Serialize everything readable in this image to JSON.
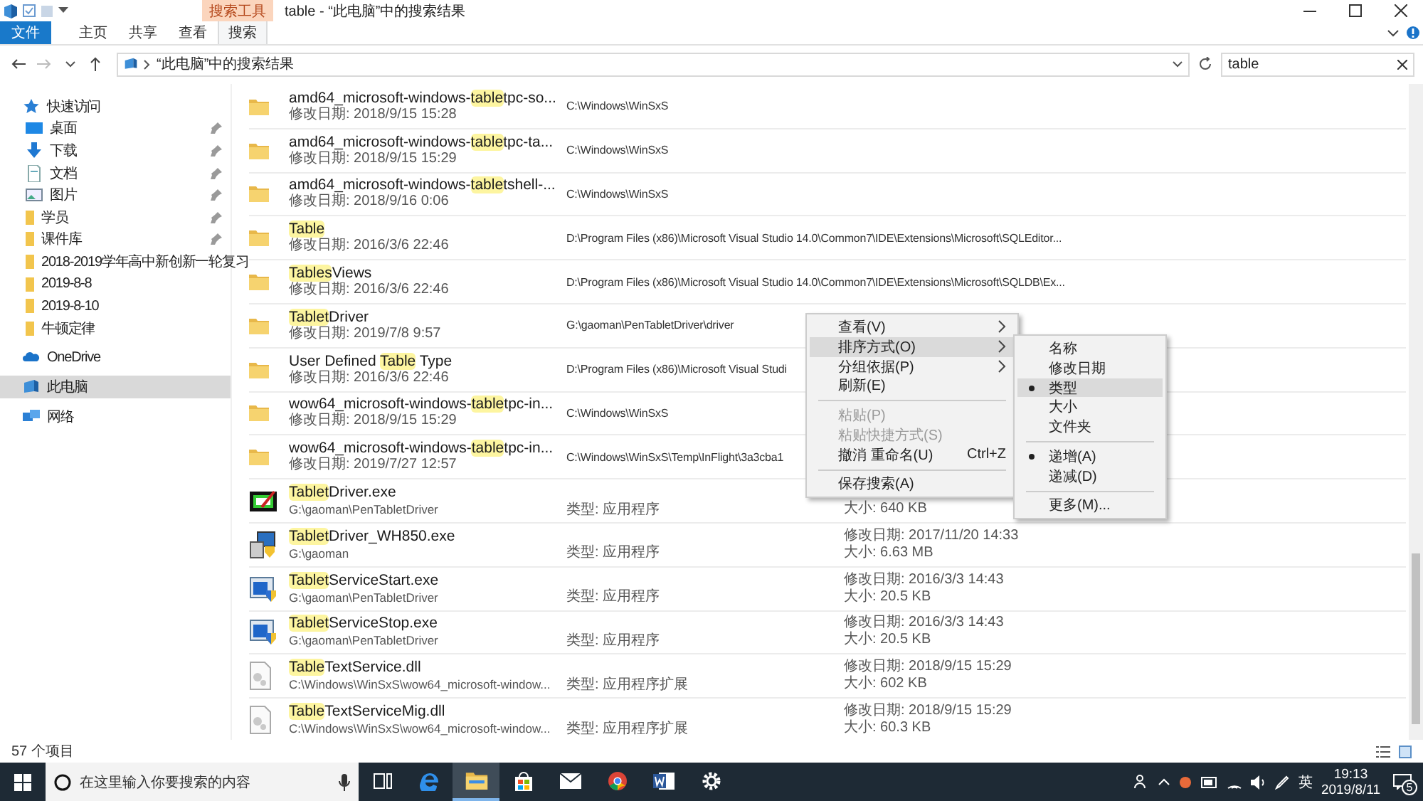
{
  "title_bar": {
    "contextual_tab": "搜索工具",
    "title": "table - “此电脑”中的搜索结果"
  },
  "ribbon_tabs": [
    {
      "label": "文件",
      "kind": "file",
      "selected": false
    },
    {
      "label": "主页",
      "kind": "tab",
      "selected": false
    },
    {
      "label": "共享",
      "kind": "tab",
      "selected": false
    },
    {
      "label": "查看",
      "kind": "tab",
      "selected": false
    },
    {
      "label": "搜索",
      "kind": "tab",
      "selected": true
    }
  ],
  "address": {
    "path": "“此电脑”中的搜索结果"
  },
  "search": {
    "value": "table"
  },
  "sidebar": {
    "items": [
      {
        "label": "快速访问",
        "kind": "star",
        "selected": false,
        "pinned": false,
        "children": [
          {
            "label": "桌面",
            "kind": "desktop",
            "selected": false,
            "pinned": true
          },
          {
            "label": "下载",
            "kind": "download",
            "selected": false,
            "pinned": true
          },
          {
            "label": "文档",
            "kind": "document",
            "selected": false,
            "pinned": true
          },
          {
            "label": "图片",
            "kind": "pictures",
            "selected": false,
            "pinned": true
          },
          {
            "label": "学员",
            "kind": "folder",
            "selected": false,
            "pinned": true
          },
          {
            "label": "课件库",
            "kind": "folder",
            "selected": false,
            "pinned": true
          },
          {
            "label": "2018-2019学年高中新创新一轮复习",
            "kind": "folder",
            "selected": false
          },
          {
            "label": "2019-8-8",
            "kind": "folder",
            "selected": false,
            "pinned": false
          },
          {
            "label": "2019-8-10",
            "kind": "folder",
            "selected": false,
            "pinned": false
          },
          {
            "label": "牛顿定律",
            "kind": "folder",
            "selected": false,
            "pinned": false
          }
        ]
      },
      {
        "label": "OneDrive",
        "kind": "cloud",
        "selected": false,
        "pinned": false
      },
      {
        "label": "此电脑",
        "kind": "computer",
        "selected": true,
        "pinned": false
      },
      {
        "label": "网络",
        "kind": "network",
        "selected": false,
        "pinned": false
      }
    ]
  },
  "files": [
    {
      "kind": "folder",
      "name": [
        {
          "text": "amd64_microsoft-windows-",
          "highlighted": false
        },
        {
          "text": "table",
          "highlighted": true
        },
        {
          "text": "tpc-so...",
          "highlighted": false
        }
      ],
      "detail": "修改日期: 2018/9/15 15:28",
      "path": "C:\\Windows\\WinSxS"
    },
    {
      "kind": "folder",
      "name": [
        {
          "text": "amd64_microsoft-windows-",
          "highlighted": false
        },
        {
          "text": "table",
          "highlighted": true
        },
        {
          "text": "tpc-ta...",
          "highlighted": false
        }
      ],
      "detail": "修改日期: 2018/9/15 15:29",
      "path": "C:\\Windows\\WinSxS"
    },
    {
      "kind": "folder",
      "name": [
        {
          "text": "amd64_microsoft-windows-",
          "highlighted": false
        },
        {
          "text": "table",
          "highlighted": true
        },
        {
          "text": "tshell-...",
          "highlighted": false
        }
      ],
      "detail": "修改日期: 2018/9/16 0:06",
      "path": "C:\\Windows\\WinSxS"
    },
    {
      "kind": "folder",
      "name": [
        {
          "text": "Table",
          "highlighted": true
        }
      ],
      "detail": "修改日期: 2016/3/6 22:46",
      "path": "D:\\Program Files (x86)\\Microsoft Visual Studio 14.0\\Common7\\IDE\\Extensions\\Microsoft\\SQLEditor..."
    },
    {
      "kind": "folder",
      "name": [
        {
          "text": "Tables",
          "highlighted": true
        },
        {
          "text": "Views",
          "highlighted": false
        }
      ],
      "detail": "修改日期: 2016/3/6 22:46",
      "path": "D:\\Program Files (x86)\\Microsoft Visual Studio 14.0\\Common7\\IDE\\Extensions\\Microsoft\\SQLDB\\Ex..."
    },
    {
      "kind": "folder",
      "name": [
        {
          "text": "Tablet",
          "highlighted": true
        },
        {
          "text": "Driver",
          "highlighted": false
        }
      ],
      "detail": "修改日期: 2019/7/8 9:57",
      "path": "G:\\gaoman\\PenTabletDriver\\driver"
    },
    {
      "kind": "folder",
      "name": [
        {
          "text": "User Defined ",
          "highlighted": false
        },
        {
          "text": "Table",
          "highlighted": true
        },
        {
          "text": " Type",
          "highlighted": false
        }
      ],
      "detail": "修改日期: 2016/3/6 22:46",
      "path": "D:\\Program Files (x86)\\Microsoft Visual Studi"
    },
    {
      "kind": "folder",
      "name": [
        {
          "text": "wow64_microsoft-windows-",
          "highlighted": false
        },
        {
          "text": "table",
          "highlighted": true
        },
        {
          "text": "tpc-in...",
          "highlighted": false
        }
      ],
      "detail": "修改日期: 2018/9/15 15:29",
      "path": "C:\\Windows\\WinSxS"
    },
    {
      "kind": "folder",
      "name": [
        {
          "text": "wow64_microsoft-windows-",
          "highlighted": false
        },
        {
          "text": "table",
          "highlighted": true
        },
        {
          "text": "tpc-in...",
          "highlighted": false
        }
      ],
      "detail": "修改日期: 2019/7/27 12:57",
      "path": "C:\\Windows\\WinSxS\\Temp\\InFlight\\3a3cba1"
    },
    {
      "kind": "tablet-app",
      "name": [
        {
          "text": "Tablet",
          "highlighted": true
        },
        {
          "text": "Driver.exe",
          "highlighted": false
        }
      ],
      "detail": "G:\\gaoman\\PenTabletDriver",
      "type": "类型: 应用程序",
      "size": "大小: 640 KB"
    },
    {
      "kind": "setup-app",
      "name": [
        {
          "text": "Tablet",
          "highlighted": true
        },
        {
          "text": "Driver_WH850.exe",
          "highlighted": false
        }
      ],
      "detail": "G:\\gaoman",
      "type": "类型: 应用程序",
      "modified": "修改日期: 2017/11/20 14:33",
      "size": "大小: 6.63 MB"
    },
    {
      "kind": "service-app",
      "name": [
        {
          "text": "Tablet",
          "highlighted": true
        },
        {
          "text": "ServiceStart.exe",
          "highlighted": false
        }
      ],
      "detail": "G:\\gaoman\\PenTabletDriver",
      "type": "类型: 应用程序",
      "modified": "修改日期: 2016/3/3 14:43",
      "size": "大小: 20.5 KB"
    },
    {
      "kind": "service-app",
      "name": [
        {
          "text": "Tablet",
          "highlighted": true
        },
        {
          "text": "ServiceStop.exe",
          "highlighted": false
        }
      ],
      "detail": "G:\\gaoman\\PenTabletDriver",
      "type": "类型: 应用程序",
      "modified": "修改日期: 2016/3/3 14:43",
      "size": "大小: 20.5 KB"
    },
    {
      "kind": "dll",
      "name": [
        {
          "text": "Table",
          "highlighted": true
        },
        {
          "text": "TextService.dll",
          "highlighted": false
        }
      ],
      "detail": "C:\\Windows\\WinSxS\\wow64_microsoft-window...",
      "type": "类型: 应用程序扩展",
      "modified": "修改日期: 2018/9/15 15:29",
      "size": "大小: 602 KB"
    },
    {
      "kind": "dll",
      "name": [
        {
          "text": "Table",
          "highlighted": true
        },
        {
          "text": "TextServiceMig.dll",
          "highlighted": false
        }
      ],
      "detail": "C:\\Windows\\WinSxS\\wow64_microsoft-window...",
      "type": "类型: 应用程序扩展",
      "modified": "修改日期: 2018/9/15 15:29",
      "size": "大小: 60.3 KB"
    }
  ],
  "context_menu": {
    "items": [
      {
        "kind": "item",
        "label": "查看(V)",
        "submenu": true,
        "disabled": false,
        "selected": false
      },
      {
        "kind": "item",
        "label": "排序方式(O)",
        "submenu": true,
        "disabled": false,
        "selected": true
      },
      {
        "kind": "item",
        "label": "分组依据(P)",
        "submenu": true,
        "disabled": false,
        "selected": false
      },
      {
        "kind": "item",
        "label": "刷新(E)",
        "submenu": false,
        "disabled": false,
        "selected": false
      },
      {
        "kind": "separator"
      },
      {
        "kind": "item",
        "label": "粘贴(P)",
        "submenu": false,
        "disabled": true,
        "selected": false
      },
      {
        "kind": "item",
        "label": "粘贴快捷方式(S)",
        "submenu": false,
        "disabled": true,
        "selected": false
      },
      {
        "kind": "item",
        "label": "撤消 重命名(U)",
        "shortcut": "Ctrl+Z",
        "submenu": false,
        "disabled": false,
        "selected": false
      },
      {
        "kind": "separator"
      },
      {
        "kind": "item",
        "label": "保存搜索(A)",
        "submenu": false,
        "disabled": false,
        "selected": false
      }
    ]
  },
  "sort_submenu": {
    "items": [
      {
        "kind": "item",
        "label": "名称",
        "checked": false,
        "selected": false
      },
      {
        "kind": "item",
        "label": "修改日期",
        "checked": false,
        "selected": false
      },
      {
        "kind": "item",
        "label": "类型",
        "checked": true,
        "selected": true
      },
      {
        "kind": "item",
        "label": "大小",
        "checked": false,
        "selected": false
      },
      {
        "kind": "item",
        "label": "文件夹",
        "checked": false,
        "selected": false
      },
      {
        "kind": "separator"
      },
      {
        "kind": "item",
        "label": "递增(A)",
        "checked": true,
        "selected": false
      },
      {
        "kind": "item",
        "label": "递减(D)",
        "checked": false,
        "selected": false
      },
      {
        "kind": "separator"
      },
      {
        "kind": "item",
        "label": "更多(M)...",
        "checked": false,
        "selected": false
      }
    ]
  },
  "status_bar": {
    "count": "57 个项目"
  },
  "taskbar": {
    "search_placeholder": "在这里输入你要搜索的内容",
    "apps": [
      {
        "kind": "task-view",
        "active": false
      },
      {
        "kind": "browser",
        "active": false
      },
      {
        "kind": "explorer",
        "active": true
      },
      {
        "kind": "store",
        "active": false
      },
      {
        "kind": "mail",
        "active": false
      },
      {
        "kind": "chrome",
        "active": false
      },
      {
        "kind": "word",
        "active": false
      },
      {
        "kind": "settings",
        "active": false
      }
    ],
    "input_method": "英",
    "time": "19:13",
    "date": "2019/8/11",
    "notification_count": "5"
  }
}
